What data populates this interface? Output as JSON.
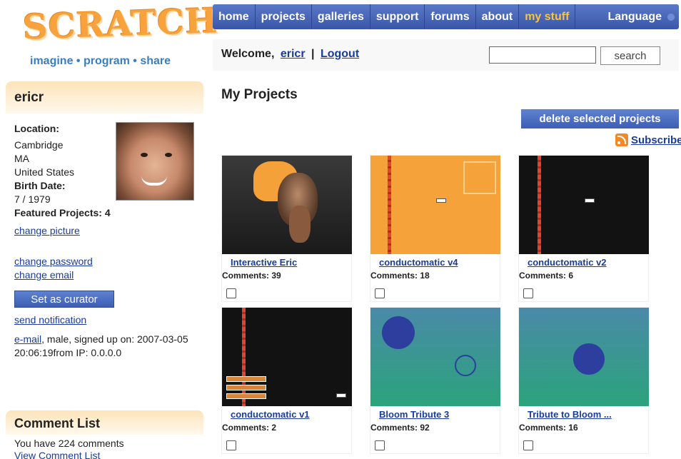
{
  "logo": {
    "word": "SCRATCH",
    "tagline": "imagine • program • share"
  },
  "nav": {
    "items": [
      "home",
      "projects",
      "galleries",
      "support",
      "forums",
      "about",
      "my stuff"
    ],
    "language": "Language"
  },
  "welcome": {
    "prefix": "Welcome,",
    "username": "ericr",
    "separator": "|",
    "logout": "Logout",
    "search_value": "",
    "search_button": "search"
  },
  "profile": {
    "username": "ericr",
    "location_label": "Location:",
    "city": "Cambridge",
    "state": "MA",
    "country": "United States",
    "birth_label": "Birth Date:",
    "birth_value": "7 / 1979",
    "featured_label": "Featured Projects:",
    "featured_value": "4",
    "change_picture": "change picture",
    "change_password": "change password",
    "change_email": "change email",
    "curator_button": "Set as curator",
    "send_notification": "send notification",
    "email_link": "e-mail",
    "info_text": ", male, signed up on: 2007-03-05 20:06:19from IP: 0.0.0.0"
  },
  "comments": {
    "title": "Comment List",
    "count_text": "You have 224 comments",
    "view_link": "View Comment List"
  },
  "main": {
    "title": "My Projects",
    "delete_button": "delete selected projects",
    "subscribe": "Subscribe"
  },
  "projects": [
    {
      "title": "Interactive Eric",
      "comments": "Comments: 39"
    },
    {
      "title": "conductomatic v4",
      "comments": "Comments: 18"
    },
    {
      "title": "conductomatic v2",
      "comments": "Comments: 6"
    },
    {
      "title": "conductomatic v1",
      "comments": "Comments: 2"
    },
    {
      "title": "Bloom Tribute 3",
      "comments": "Comments: 92"
    },
    {
      "title": "Tribute to Bloom ...",
      "comments": "Comments: 16"
    }
  ],
  "colors": {
    "nav_bg": "#4a67b8",
    "active_nav": "#f8c440",
    "link": "#1a3d9c",
    "sidebar_header": "#fde4ba"
  }
}
